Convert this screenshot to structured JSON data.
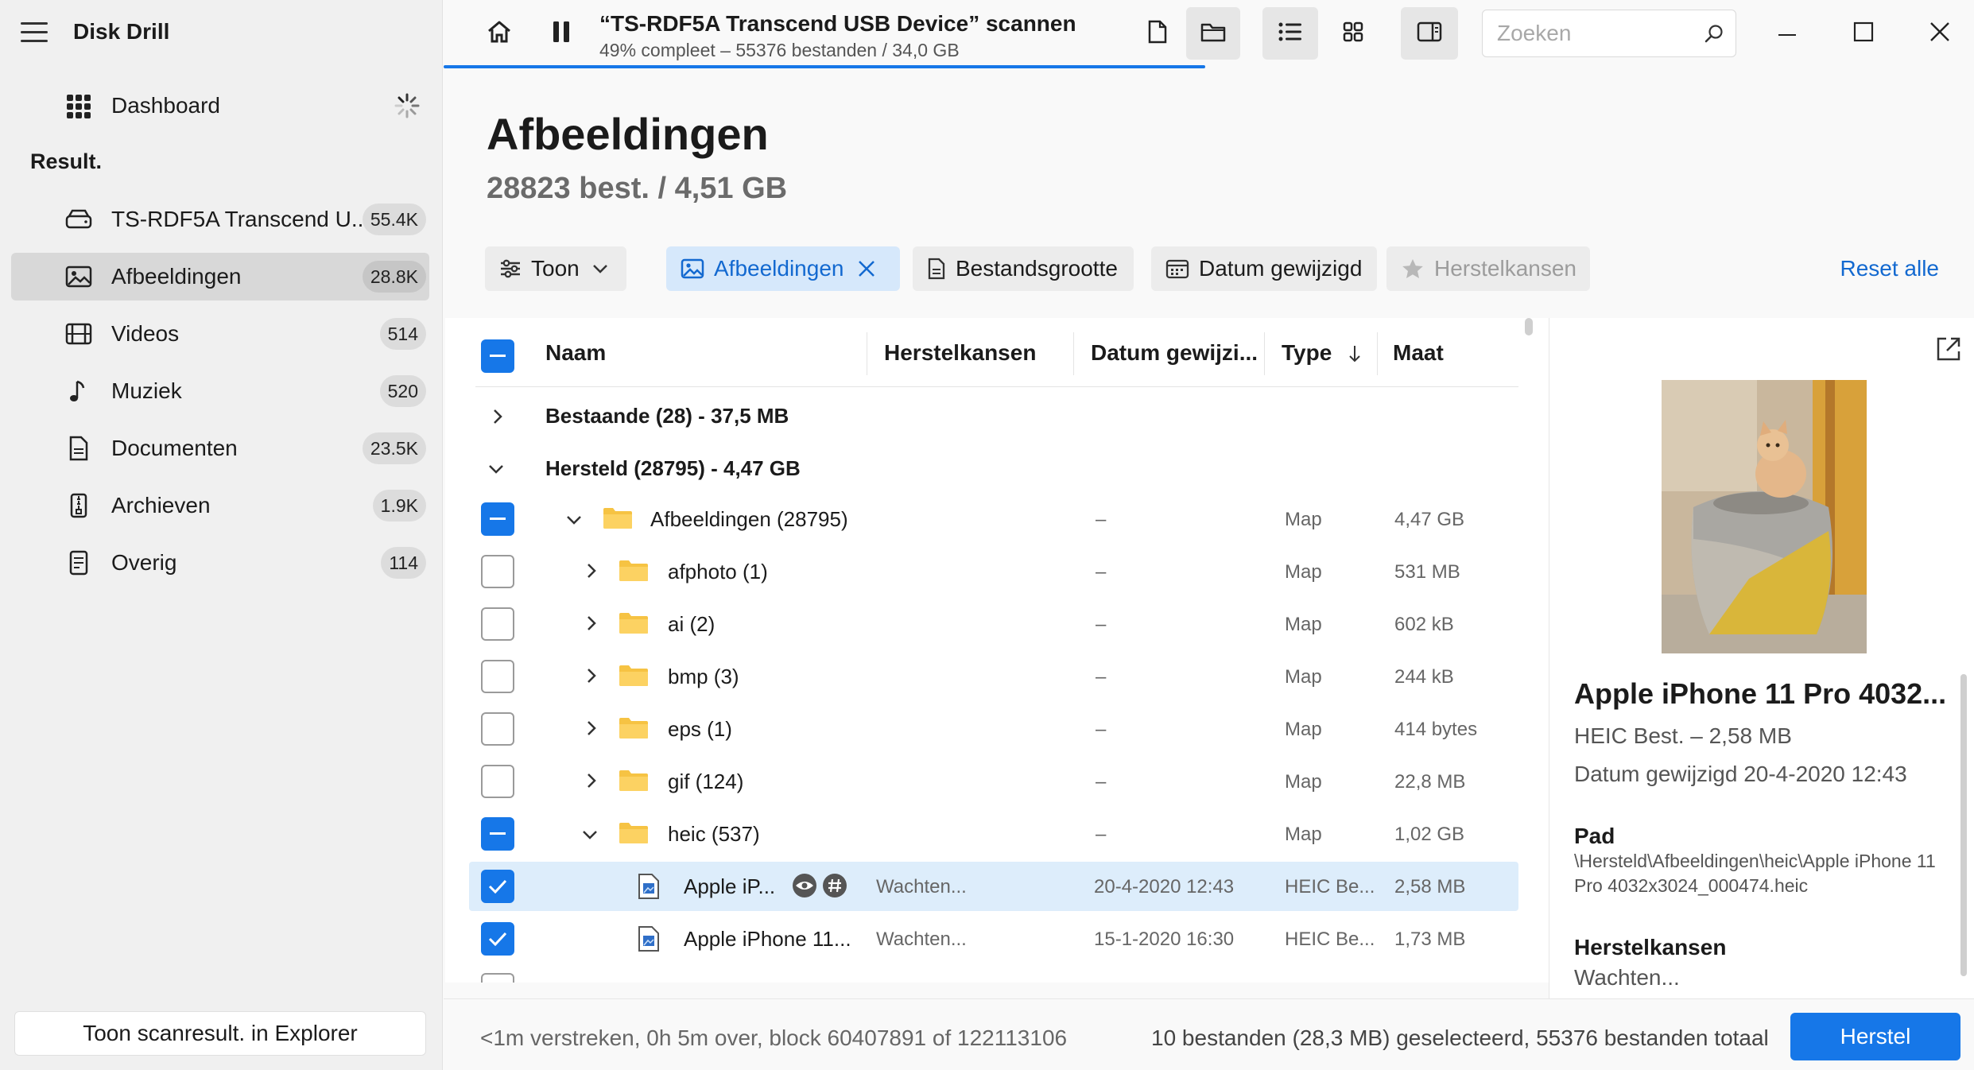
{
  "app": {
    "title": "Disk Drill"
  },
  "sidebar": {
    "dashboard_label": "Dashboard",
    "result_header": "Result.",
    "items": [
      {
        "label": "TS-RDF5A Transcend U...",
        "count": "55.4K",
        "icon": "drive-icon"
      },
      {
        "label": "Afbeeldingen",
        "count": "28.8K",
        "icon": "image-icon",
        "active": true
      },
      {
        "label": "Videos",
        "count": "514",
        "icon": "film-icon"
      },
      {
        "label": "Muziek",
        "count": "520",
        "icon": "music-note-icon"
      },
      {
        "label": "Documenten",
        "count": "23.5K",
        "icon": "document-icon"
      },
      {
        "label": "Archieven",
        "count": "1.9K",
        "icon": "archive-icon"
      },
      {
        "label": "Overig",
        "count": "114",
        "icon": "other-file-icon"
      }
    ],
    "explorer_button": "Toon scanresult. in Explorer"
  },
  "topbar": {
    "scan_title": "“TS-RDF5A Transcend USB Device” scannen",
    "scan_subtitle": "49% compleet – 55376 bestanden / 34,0 GB",
    "progress": 0.49,
    "search_placeholder": "Zoeken"
  },
  "header": {
    "title": "Afbeeldingen",
    "subtitle": "28823 best. / 4,51 GB"
  },
  "filters": {
    "show": "Toon",
    "images": "Afbeeldingen",
    "filesize": "Bestandsgrootte",
    "date_modified": "Datum gewijzigd",
    "recovery_chances": "Herstelkansen",
    "reset_all": "Reset alle"
  },
  "table": {
    "columns": {
      "name": "Naam",
      "chances": "Herstelkansen",
      "date": "Datum gewijzi...",
      "type": "Type",
      "size": "Maat"
    },
    "groups": [
      {
        "label": "Bestaande (28) - 37,5 MB"
      },
      {
        "label": "Hersteld (28795) - 4,47 GB"
      }
    ],
    "rows": [
      {
        "name": "Afbeeldingen (28795)",
        "chances": "–",
        "date": "",
        "type": "Map",
        "size": "4,47 GB"
      },
      {
        "name": "afphoto (1)",
        "chances": "–",
        "date": "",
        "type": "Map",
        "size": "531 MB"
      },
      {
        "name": "ai (2)",
        "chances": "–",
        "date": "",
        "type": "Map",
        "size": "602 kB"
      },
      {
        "name": "bmp (3)",
        "chances": "–",
        "date": "",
        "type": "Map",
        "size": "244 kB"
      },
      {
        "name": "eps (1)",
        "chances": "–",
        "date": "",
        "type": "Map",
        "size": "414 bytes"
      },
      {
        "name": "gif (124)",
        "chances": "–",
        "date": "",
        "type": "Map",
        "size": "22,8 MB"
      },
      {
        "name": "heic (537)",
        "chances": "–",
        "date": "",
        "type": "Map",
        "size": "1,02 GB"
      },
      {
        "name": "Apple iP...",
        "chances": "Wachten...",
        "date": "20-4-2020 12:43",
        "type": "HEIC Be...",
        "size": "2,58 MB"
      },
      {
        "name": "Apple iPhone 11...",
        "chances": "Wachten...",
        "date": "15-1-2020 16:30",
        "type": "HEIC Be...",
        "size": "1,73 MB"
      }
    ]
  },
  "preview": {
    "title": "Apple iPhone 11 Pro 4032...",
    "file_info": "HEIC Best. – 2,58 MB",
    "date_info": "Datum gewijzigd 20-4-2020 12:43",
    "path_label": "Pad",
    "path_value": "\\Hersteld\\Afbeeldingen\\heic\\Apple iPhone 11 Pro 4032x3024_000474.heic",
    "chances_label": "Herstelkansen",
    "chances_value": "Wachten..."
  },
  "status": {
    "left": "<1m verstreken, 0h 5m over, block 60407891 of 122113106",
    "right": "10 bestanden (28,3 MB) geselecteerd, 55376 bestanden totaal",
    "recover_button": "Herstel"
  },
  "colors": {
    "accent": "#1677e8",
    "folder": "#f6c343"
  }
}
